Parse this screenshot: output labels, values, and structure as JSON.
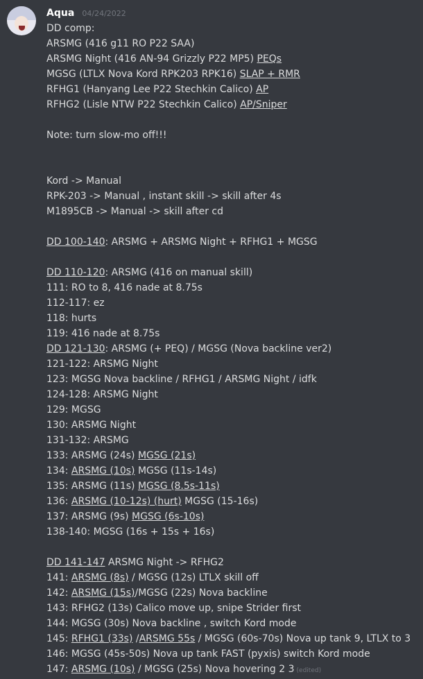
{
  "author": {
    "name": "Aqua",
    "timestamp": "04/24/2022"
  },
  "edited_label": "(edited)",
  "lines": [
    [
      {
        "t": "DD comp:"
      }
    ],
    [
      {
        "t": "ARSMG (416 g11 RO P22 SAA)"
      }
    ],
    [
      {
        "t": "ARSMG Night (416 AN-94 Grizzly P22 MP5) "
      },
      {
        "t": "PEQs",
        "u": true
      }
    ],
    [
      {
        "t": "MGSG  (LTLX Nova Kord RPK203 RPK16)  "
      },
      {
        "t": "SLAP + RMR",
        "u": true
      }
    ],
    [
      {
        "t": "RFHG1 (Hanyang Lee P22 Stechkin Calico) "
      },
      {
        "t": "AP",
        "u": true
      }
    ],
    [
      {
        "t": "RFHG2  (Lisle NTW P22 Stechkin Calico)  "
      },
      {
        "t": "AP/Sniper",
        "u": true
      }
    ],
    [],
    [
      {
        "t": "Note: turn slow-mo off!!!"
      }
    ],
    [],
    [],
    [
      {
        "t": "Kord -> Manual"
      }
    ],
    [
      {
        "t": "RPK-203 -> Manual , instant skill -> skill after 4s"
      }
    ],
    [
      {
        "t": "M1895CB -> Manual -> skill after cd"
      }
    ],
    [],
    [
      {
        "t": "DD 100-140",
        "u": true
      },
      {
        "t": ": ARSMG + ARSMG Night + RFHG1 + MGSG"
      }
    ],
    [],
    [
      {
        "t": "DD 110-120",
        "u": true
      },
      {
        "t": ": ARSMG (416 on manual skill)"
      }
    ],
    [
      {
        "t": "111: RO to 8, 416 nade at 8.75s"
      }
    ],
    [
      {
        "t": "112-117: ez"
      }
    ],
    [
      {
        "t": "118: hurts"
      }
    ],
    [
      {
        "t": "119: 416 nade at 8.75s"
      }
    ],
    [
      {
        "t": "DD 121-130",
        "u": true
      },
      {
        "t": ": ARSMG (+ PEQ) / MGSG (Nova backline ver2)"
      }
    ],
    [
      {
        "t": "121-122: ARSMG Night"
      }
    ],
    [
      {
        "t": "123: MGSG Nova backline / RFHG1 / ARSMG Night / idfk"
      }
    ],
    [
      {
        "t": "124-128: ARSMG Night"
      }
    ],
    [
      {
        "t": "129: MGSG"
      }
    ],
    [
      {
        "t": "130: ARSMG Night"
      }
    ],
    [
      {
        "t": "131-132: ARSMG"
      }
    ],
    [
      {
        "t": "133: ARSMG (24s) "
      },
      {
        "t": "MGSG (21s)",
        "u": true
      }
    ],
    [
      {
        "t": "134: "
      },
      {
        "t": "ARSMG (10s)",
        "u": true
      },
      {
        "t": " MGSG (11s-14s)"
      }
    ],
    [
      {
        "t": "135: ARSMG (11s) "
      },
      {
        "t": "MGSG (8.5s-11s)",
        "u": true
      }
    ],
    [
      {
        "t": "136: "
      },
      {
        "t": "ARSMG (10-12s) (hurt)",
        "u": true
      },
      {
        "t": " MGSG (15-16s)"
      }
    ],
    [
      {
        "t": "137: ARSMG (9s) "
      },
      {
        "t": "MGSG (6s-10s)",
        "u": true
      }
    ],
    [
      {
        "t": "138-140: MGSG (16s + 15s + 16s)"
      }
    ],
    [],
    [
      {
        "t": "DD 141-147",
        "u": true
      },
      {
        "t": "  ARSMG Night -> RFHG2"
      }
    ],
    [
      {
        "t": "141: "
      },
      {
        "t": "ARSMG (8s)",
        "u": true
      },
      {
        "t": " / MGSG (12s) LTLX skill off"
      }
    ],
    [
      {
        "t": "142: "
      },
      {
        "t": "ARSMG (15s)",
        "u": true
      },
      {
        "t": "/MGSG (22s) Nova backline"
      }
    ],
    [
      {
        "t": "143: RFHG2 (13s) Calico move up, snipe Strider first"
      }
    ],
    [
      {
        "t": "144: MGSG (30s) Nova backline , switch Kord mode"
      }
    ],
    [
      {
        "t": "145: "
      },
      {
        "t": "RFHG1 (33s)",
        "u": true
      },
      {
        "t": " /"
      },
      {
        "t": "ARSMG 55s",
        "u": true
      },
      {
        "t": " / MGSG (60s-70s) Nova up tank 9, LTLX to 3"
      }
    ],
    [
      {
        "t": "146: MGSG (45s-50s) Nova up tank FAST (pyxis) switch Kord mode"
      }
    ],
    [
      {
        "t": "147: "
      },
      {
        "t": "ARSMG (10s)",
        "u": true
      },
      {
        "t": " / MGSG (25s) Nova hovering 2 3"
      }
    ]
  ]
}
